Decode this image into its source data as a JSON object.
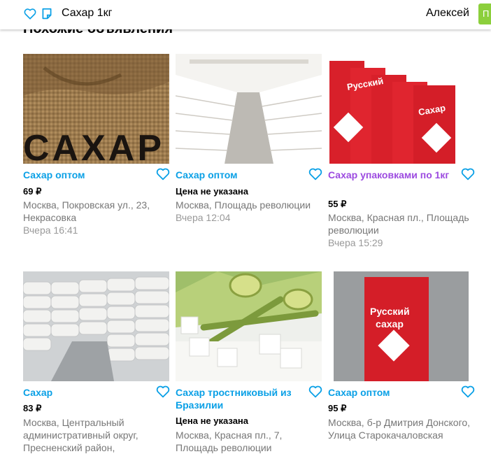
{
  "header": {
    "search_query": "Сахар 1кг",
    "user_name": "Алексей",
    "button_label": "П"
  },
  "section_title": "Похожие объявления",
  "colors": {
    "link": "#0aa0e6",
    "visited": "#9c4ae0",
    "green": "#8ccf3c"
  },
  "items": [
    {
      "title": "Сахар оптом",
      "price": "69 ₽",
      "address": "Москва, Покровская ул., 23, Некрасовка",
      "time": "Вчера 16:41",
      "image": "burlap-sack-icon"
    },
    {
      "title": "Сахар оптом",
      "price": "Цена не указана",
      "address": "Москва, Площадь революции",
      "time": "Вчера 12:04",
      "image": "warehouse-icon"
    },
    {
      "title": "Сахар упаковками по 1кг",
      "price": "55 ₽",
      "address": "Москва, Красная пл., Площадь революции",
      "time": "Вчера 15:29",
      "image": "sugar-packs-icon"
    },
    {
      "title": "Сахар",
      "price": "83 ₽",
      "address": "Москва, Центральный административный округ, Пресненский район,",
      "time": "",
      "image": "sack-stacks-icon"
    },
    {
      "title": "Сахар тростниковый из Бразилии",
      "price": "Цена не указана",
      "address": "Москва, Красная пл., 7, Площадь революции",
      "time": "",
      "image": "sugarcane-icon"
    },
    {
      "title": "Сахар оптом",
      "price": "95 ₽",
      "address": "Москва, б-р Дмитрия Донского, Улица Старокачаловская",
      "time": "",
      "image": "sugar-pack-icon"
    }
  ]
}
